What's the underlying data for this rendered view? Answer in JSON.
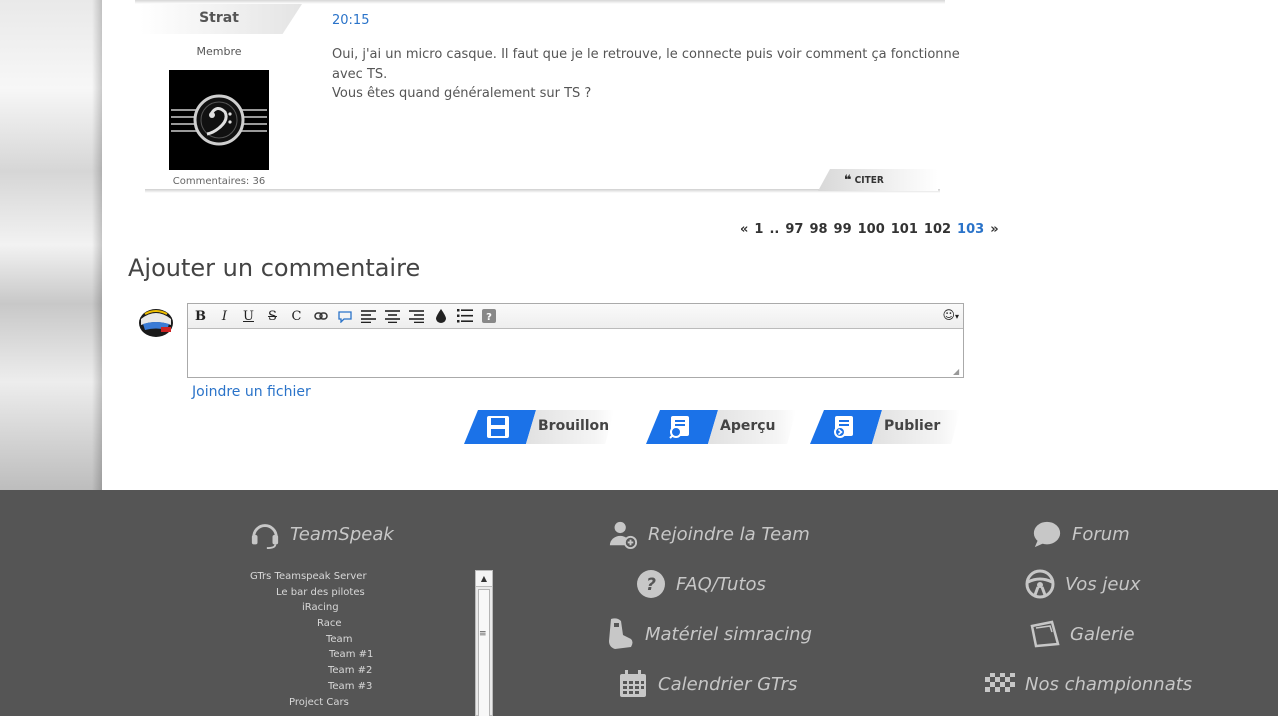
{
  "post": {
    "author": "Strat",
    "time": "20:15",
    "role": "Membre",
    "comment_count": "Commentaires: 36",
    "body_line1": "Oui, j'ai un micro casque. Il faut que je le retrouve, le connecte puis voir comment ça fonctionne avec TS.",
    "body_line2": "Vous êtes quand généralement sur TS ?",
    "quote_label": "CITER",
    "quote_icon": "quote-icon"
  },
  "pagination": {
    "prev": "«",
    "items": [
      "1",
      "..",
      "97",
      "98",
      "99",
      "100",
      "101",
      "102",
      "103"
    ],
    "current": "103",
    "next": "»"
  },
  "comment": {
    "heading": "Ajouter un commentaire",
    "toolbar": [
      "B",
      "I",
      "U",
      "S",
      "C",
      "link",
      "bubble",
      "align-left",
      "align-center",
      "align-right",
      "color",
      "list",
      "help"
    ],
    "emoji_label": "☺",
    "textarea_value": "",
    "attach_label": "Joindre un fichier",
    "buttons": {
      "draft": "Brouillon",
      "preview": "Aperçu",
      "publish": "Publier"
    }
  },
  "footer": {
    "teamspeak": "TeamSpeak",
    "join": "Rejoindre la Team",
    "forum": "Forum",
    "faq": "FAQ/Tutos",
    "games": "Vos jeux",
    "gear": "Matériel simracing",
    "gallery": "Galerie",
    "calendar": "Calendrier GTrs",
    "championships": "Nos championnats",
    "ts_tree": [
      "GTrs Teamspeak Server",
      "Le bar des pilotes",
      "iRacing",
      "Race",
      "Team",
      "Team #1",
      "Team #2",
      "Team #3",
      "Project Cars"
    ]
  },
  "colors": {
    "accent": "#1b72e8",
    "link": "#2a73c9",
    "footer_bg": "#555555"
  }
}
